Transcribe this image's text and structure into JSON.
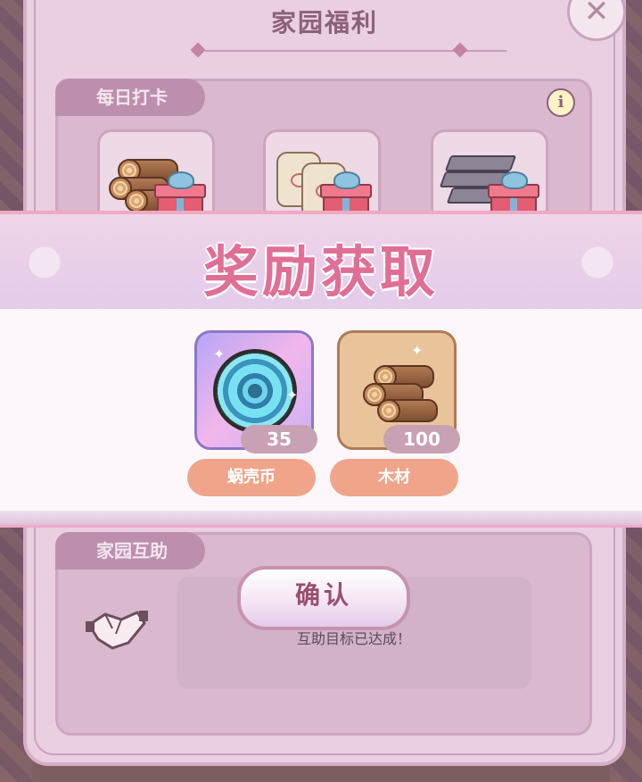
{
  "panel": {
    "title": "家园福利",
    "close_symbol": "✕"
  },
  "daily_checkin": {
    "tab_label": "每日打卡",
    "info_symbol": "i",
    "slots": [
      {
        "icon": "wood-logs-gift-icon"
      },
      {
        "icon": "flour-sacks-gift-icon"
      },
      {
        "icon": "metal-planks-gift-icon"
      }
    ]
  },
  "reward_popup": {
    "title": "奖励获取",
    "items": [
      {
        "name": "蜗壳币",
        "count": "35",
        "icon": "shell-coin-icon"
      },
      {
        "name": "木材",
        "count": "100",
        "icon": "wood-logs-icon"
      }
    ],
    "confirm_label": "确认"
  },
  "mutual_help": {
    "tab_label": "家园互助",
    "status_text": "互助目标已达成！",
    "icon": "handshake-icon"
  },
  "colors": {
    "title_pink": "#e06f96",
    "panel_bg": "#e9cfe0",
    "name_pill": "#f0a58a",
    "count_pill": "#c9a1b5"
  }
}
